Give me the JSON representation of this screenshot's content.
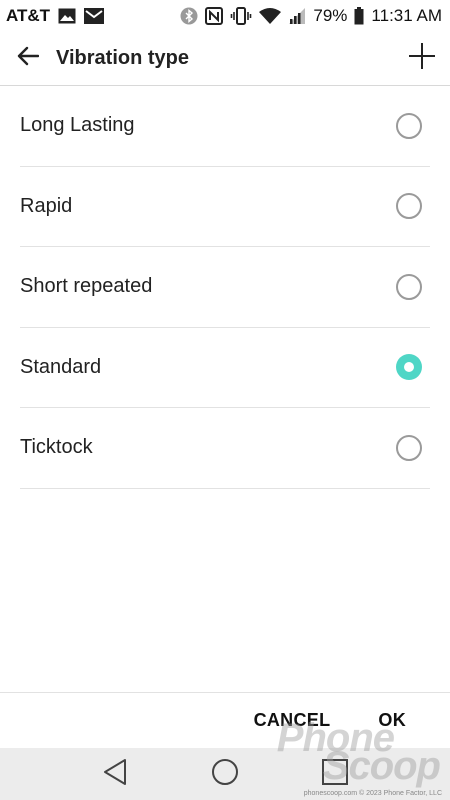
{
  "status_bar": {
    "carrier": "AT&T",
    "icons_left": [
      "image-icon",
      "gmail-icon"
    ],
    "icons_right": [
      "bluetooth-icon",
      "nfc-icon",
      "vibrate-icon",
      "wifi-icon",
      "signal-icon"
    ],
    "battery_percent": "79%",
    "time": "11:31 AM"
  },
  "app_bar": {
    "title": "Vibration type",
    "back_icon": "arrow-left-icon",
    "add_icon": "plus-icon"
  },
  "options": [
    {
      "label": "Long Lasting",
      "selected": false
    },
    {
      "label": "Rapid",
      "selected": false
    },
    {
      "label": "Short repeated",
      "selected": false
    },
    {
      "label": "Standard",
      "selected": true
    },
    {
      "label": "Ticktock",
      "selected": false
    }
  ],
  "dialog": {
    "cancel_label": "CANCEL",
    "ok_label": "OK"
  },
  "nav_bar": {
    "icons": [
      "back-triangle-icon",
      "home-circle-icon",
      "recents-square-icon"
    ]
  },
  "watermark": {
    "line1": "Phone",
    "line2": "Scoop",
    "footer": "phonescoop.com  © 2023 Phone Factor, LLC"
  },
  "colors": {
    "accent": "#4fd6c6",
    "nav_bg": "#ececec",
    "divider": "#e2e2e2"
  }
}
